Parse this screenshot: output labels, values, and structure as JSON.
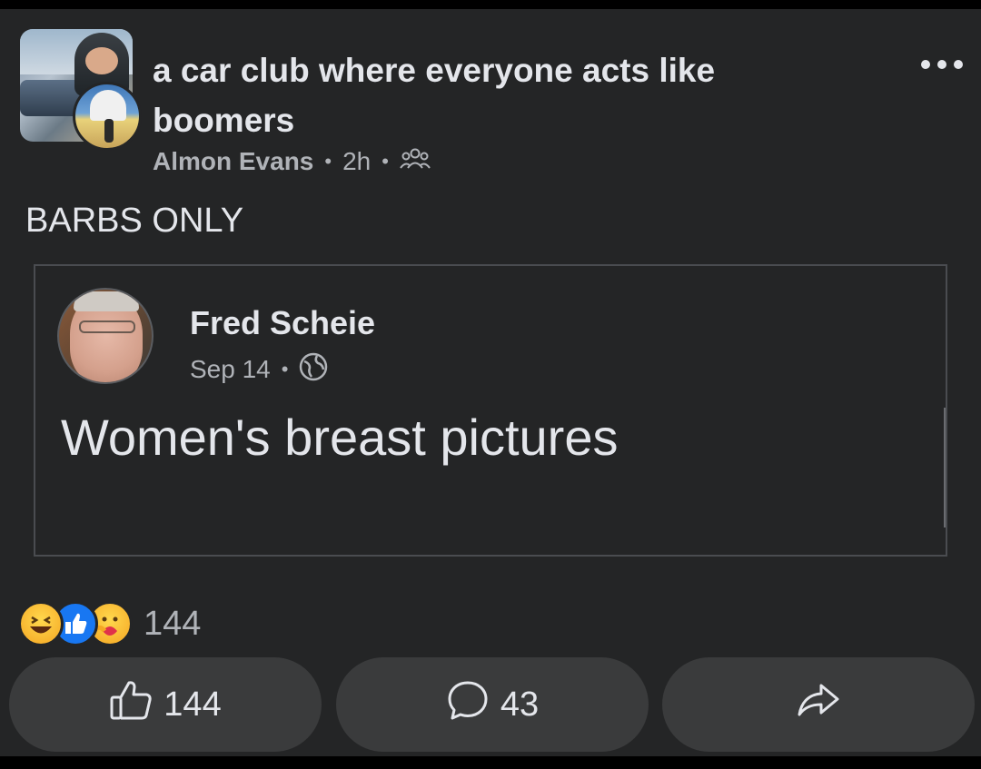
{
  "post": {
    "title": "a car club where everyone acts like boomers",
    "author": "Almon Evans",
    "time": "2h",
    "text": "BARBS ONLY"
  },
  "shared": {
    "name": "Fred Scheie",
    "date": "Sep 14",
    "body": "Women's breast pictures"
  },
  "reactions": {
    "count": "144"
  },
  "actions": {
    "like_count": "144",
    "comment_count": "43"
  },
  "colors": {
    "background": "#242526",
    "button": "#3a3b3c",
    "text": "#e4e6eb",
    "muted": "#b0b3b8",
    "like_blue": "#1877f2"
  }
}
